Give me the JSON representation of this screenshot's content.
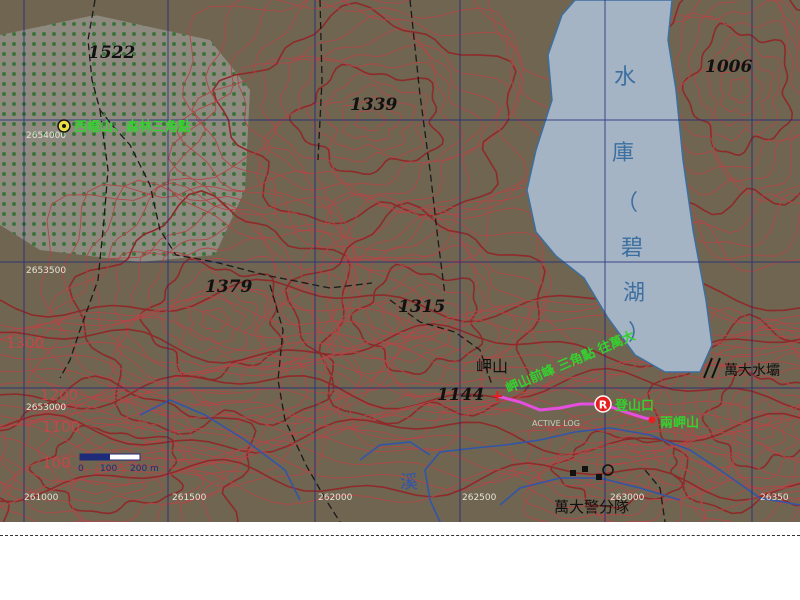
{
  "map": {
    "colors": {
      "background": "#6f6551",
      "contour": "#b04848",
      "contour_bold": "#8f2a2a",
      "lake": "#a5b4c4",
      "lake_text": "#3c6fa0",
      "grid": "#1e2a7a",
      "trail": "#1a1a1a",
      "route": "#e64ee0",
      "label_green": "#34d12f",
      "river": "#3355a8"
    },
    "elevations": [
      "1522",
      "1339",
      "1006",
      "1379",
      "1315",
      "1144",
      "1300",
      "1200",
      "1100",
      "100"
    ],
    "grid_labels": [
      "2654000",
      "2653500",
      "2653000",
      "261000",
      "261500",
      "262000",
      "262500",
      "263000",
      "26350"
    ],
    "lake_chars": [
      "水",
      "庫",
      "（",
      "碧",
      "湖",
      "）"
    ],
    "place_labels": {
      "summit_top": "西帽山、森林三角點",
      "peak": "岬山",
      "dam": "萬大水壩",
      "police": "萬大警分隊",
      "river_char": "溪",
      "rest": "兩岬山",
      "road": "ACTIVE LOG"
    },
    "green_labels": {
      "along_lake": "岬山前峰 三角點 往萬大",
      "trailhead": "登山口"
    },
    "route_marker": "R",
    "scale": {
      "labels": [
        "0",
        "100",
        "200 m"
      ]
    }
  }
}
